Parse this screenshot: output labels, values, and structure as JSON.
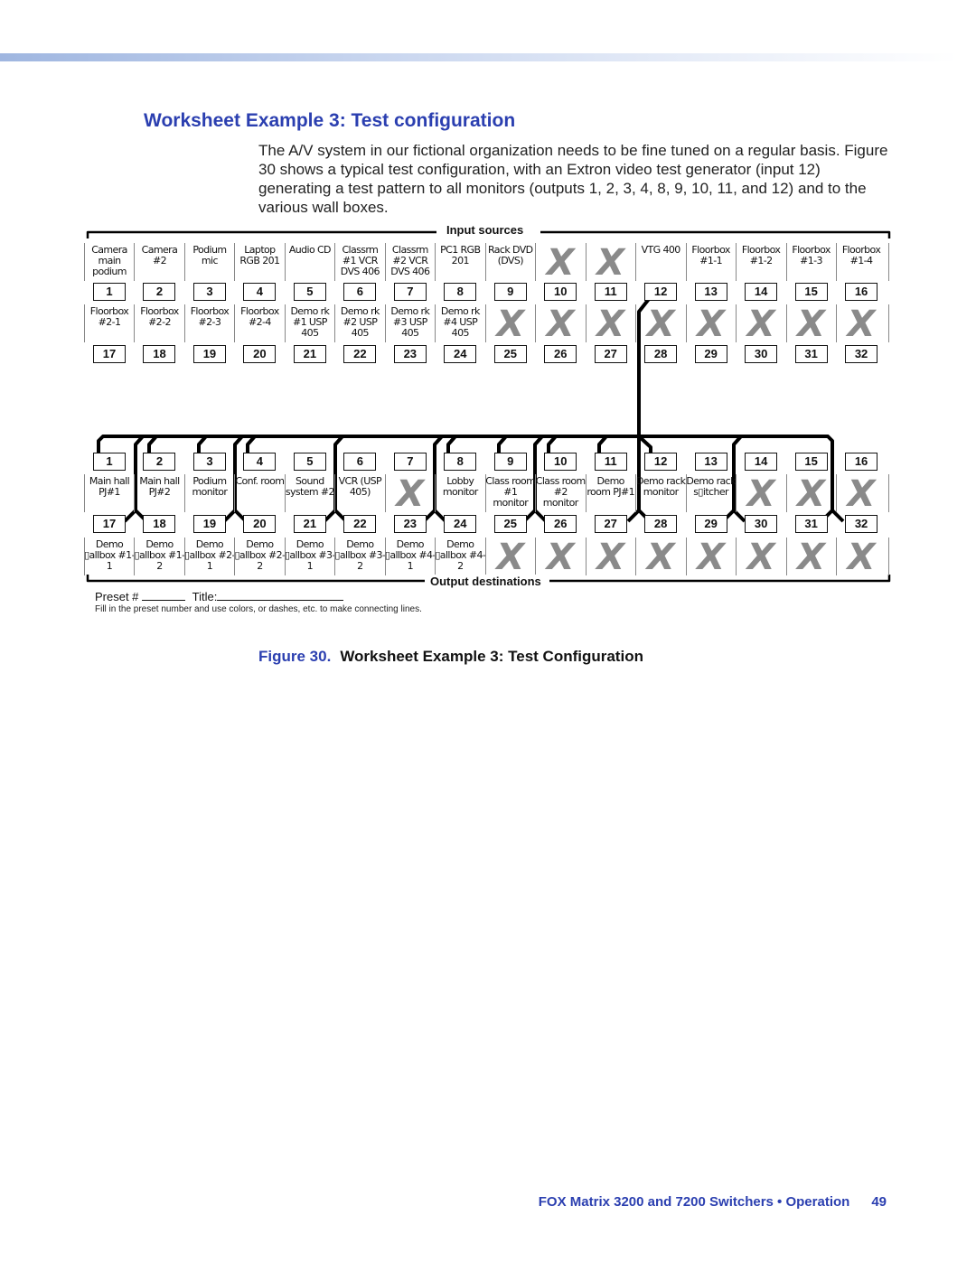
{
  "section_title": "Worksheet Example 3: Test configuration",
  "body_text": "The A/V system in our fictional organization needs to be fine tuned on a regular basis. Figure 30 shows a typical test configuration, with an Extron video test generator (input 12) generating a test pattern to all monitors (outputs 1, 2, 3, 4, 8, 9, 10, 11, and 12) and to the various wall boxes.",
  "worksheet": {
    "input_header": "Input  sources",
    "output_header": "Output destinations",
    "inputs": [
      "Camera main podium",
      "Camera #2",
      "Podium mic",
      "Laptop RGB 201",
      "Audio CD",
      "Classrm #1 VCR DVS 406",
      "Classrm #2 VCR DVS 406",
      "PC1 RGB 201",
      "Rack DVD (DVS)",
      "X",
      "X",
      "VTG 400",
      "Floorbox #1-1",
      "Floorbox #1-2",
      "Floorbox #1-3",
      "Floorbox #1-4",
      "Floorbox #2-1",
      "Floorbox #2-2",
      "Floorbox #2-3",
      "Floorbox #2-4",
      "Demo rk #1 USP 405",
      "Demo rk #2 USP 405",
      "Demo rk #3 USP 405",
      "Demo rk #4 USP 405",
      "X",
      "X",
      "X",
      "X",
      "X",
      "X",
      "X",
      "X"
    ],
    "outputs": [
      "Main hall PJ#1",
      "Main hall PJ#2",
      "Podium monitor",
      "Conf. room",
      "Sound system #2",
      "VCR (USP 405)",
      "X",
      "Lobby monitor",
      "Class room #1 monitor",
      "Class room #2 monitor",
      "Demo room PJ#1",
      "Demo rack monitor",
      "Demo rack s▯itcher",
      "X",
      "X",
      "X",
      "Demo ▯allbox #1-1",
      "Demo ▯allbox #1-2",
      "Demo ▯allbox #2-1",
      "Demo ▯allbox #2-2",
      "Demo ▯allbox #3-1",
      "Demo ▯allbox #3-2",
      "Demo ▯allbox #4-1",
      "Demo ▯allbox #4-2",
      "X",
      "X",
      "X",
      "X",
      "X",
      "X",
      "X",
      "X"
    ],
    "connection": {
      "input": 12,
      "outputs": [
        1,
        2,
        3,
        4,
        8,
        9,
        10,
        11,
        12,
        17,
        18,
        19,
        20,
        21,
        22,
        23,
        24,
        25,
        26,
        27,
        28,
        29,
        30,
        31,
        32
      ]
    },
    "preset_label": "Preset #",
    "title_label": "Title:",
    "note": "Fill in the preset number and use colors, or dashes, etc. to make connecting lines."
  },
  "figure_caption": {
    "number": "Figure 30.",
    "text": "Worksheet Example 3: Test Configuration"
  },
  "footer": {
    "text": "FOX Matrix 3200 and 7200 Switchers • Operation",
    "page": "49"
  },
  "colors": {
    "accent": "#2b3fb0",
    "x_mark": "#8a8a8a"
  }
}
